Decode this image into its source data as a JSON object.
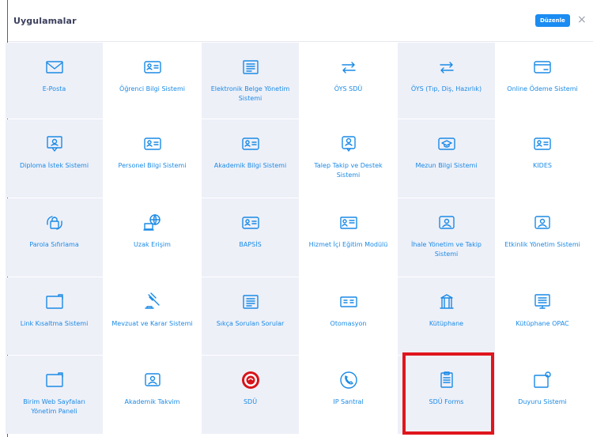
{
  "header": {
    "title": "Uygulamalar",
    "edit_label": "Düzenle",
    "close_glyph": "×"
  },
  "colors": {
    "accent": "#1a8ae6",
    "button": "#1b8cf2",
    "tile_shaded": "#eef0f8",
    "highlight": "#e0161d"
  },
  "tiles": [
    {
      "label": "E-Posta",
      "icon": "envelope-icon"
    },
    {
      "label": "Öğrenci Bilgi Sistemi",
      "icon": "id-card-icon"
    },
    {
      "label": "Elektronik Belge Yönetim Sistemi",
      "icon": "document-icon"
    },
    {
      "label": "ÖYS SDÜ",
      "icon": "exchange-arrows-icon"
    },
    {
      "label": "ÖYS (Tıp, Diş, Hazırlık)",
      "icon": "exchange-arrows-icon"
    },
    {
      "label": "Online Ödeme Sistemi",
      "icon": "credit-card-icon"
    },
    {
      "label": "Diploma İstek Sistemi",
      "icon": "certificate-icon"
    },
    {
      "label": "Personel Bilgi Sistemi",
      "icon": "id-card-icon"
    },
    {
      "label": "Akademik Bilgi Sistemi",
      "icon": "id-card-icon"
    },
    {
      "label": "Talep Takip ve Destek Sistemi",
      "icon": "support-icon"
    },
    {
      "label": "Mezun Bilgi Sistemi",
      "icon": "graduation-cap-icon"
    },
    {
      "label": "KIDES",
      "icon": "id-card-icon"
    },
    {
      "label": "Parola Sıfırlama",
      "icon": "lock-reset-icon"
    },
    {
      "label": "Uzak Erişim",
      "icon": "remote-globe-icon"
    },
    {
      "label": "BAPSİS",
      "icon": "id-card-icon"
    },
    {
      "label": "Hizmet İçi Eğitim Modülü",
      "icon": "training-icon"
    },
    {
      "label": "İhale Yönetim ve Takip Sistemi",
      "icon": "person-card-icon"
    },
    {
      "label": "Etkinlik Yönetim Sistemi",
      "icon": "person-card-icon"
    },
    {
      "label": "Link Kısaltma Sistemi",
      "icon": "window-icon"
    },
    {
      "label": "Mevzuat ve Karar Sistemi",
      "icon": "gavel-icon"
    },
    {
      "label": "Sıkça Sorulan Sorular",
      "icon": "document-icon"
    },
    {
      "label": "Otomasyon",
      "icon": "panel-icon"
    },
    {
      "label": "Kütüphane",
      "icon": "library-icon"
    },
    {
      "label": "Kütüphane OPAC",
      "icon": "library-screen-icon"
    },
    {
      "label": "Birim Web Sayfaları Yönetim Paneli",
      "icon": "window-icon"
    },
    {
      "label": "Akademik Takvim",
      "icon": "person-card-icon"
    },
    {
      "label": "SDÜ",
      "icon": "sdu-logo-icon"
    },
    {
      "label": "IP Santral",
      "icon": "phone-icon"
    },
    {
      "label": "SDÜ Forms",
      "icon": "clipboard-icon"
    },
    {
      "label": "Duyuru Sistemi",
      "icon": "notification-icon"
    }
  ]
}
